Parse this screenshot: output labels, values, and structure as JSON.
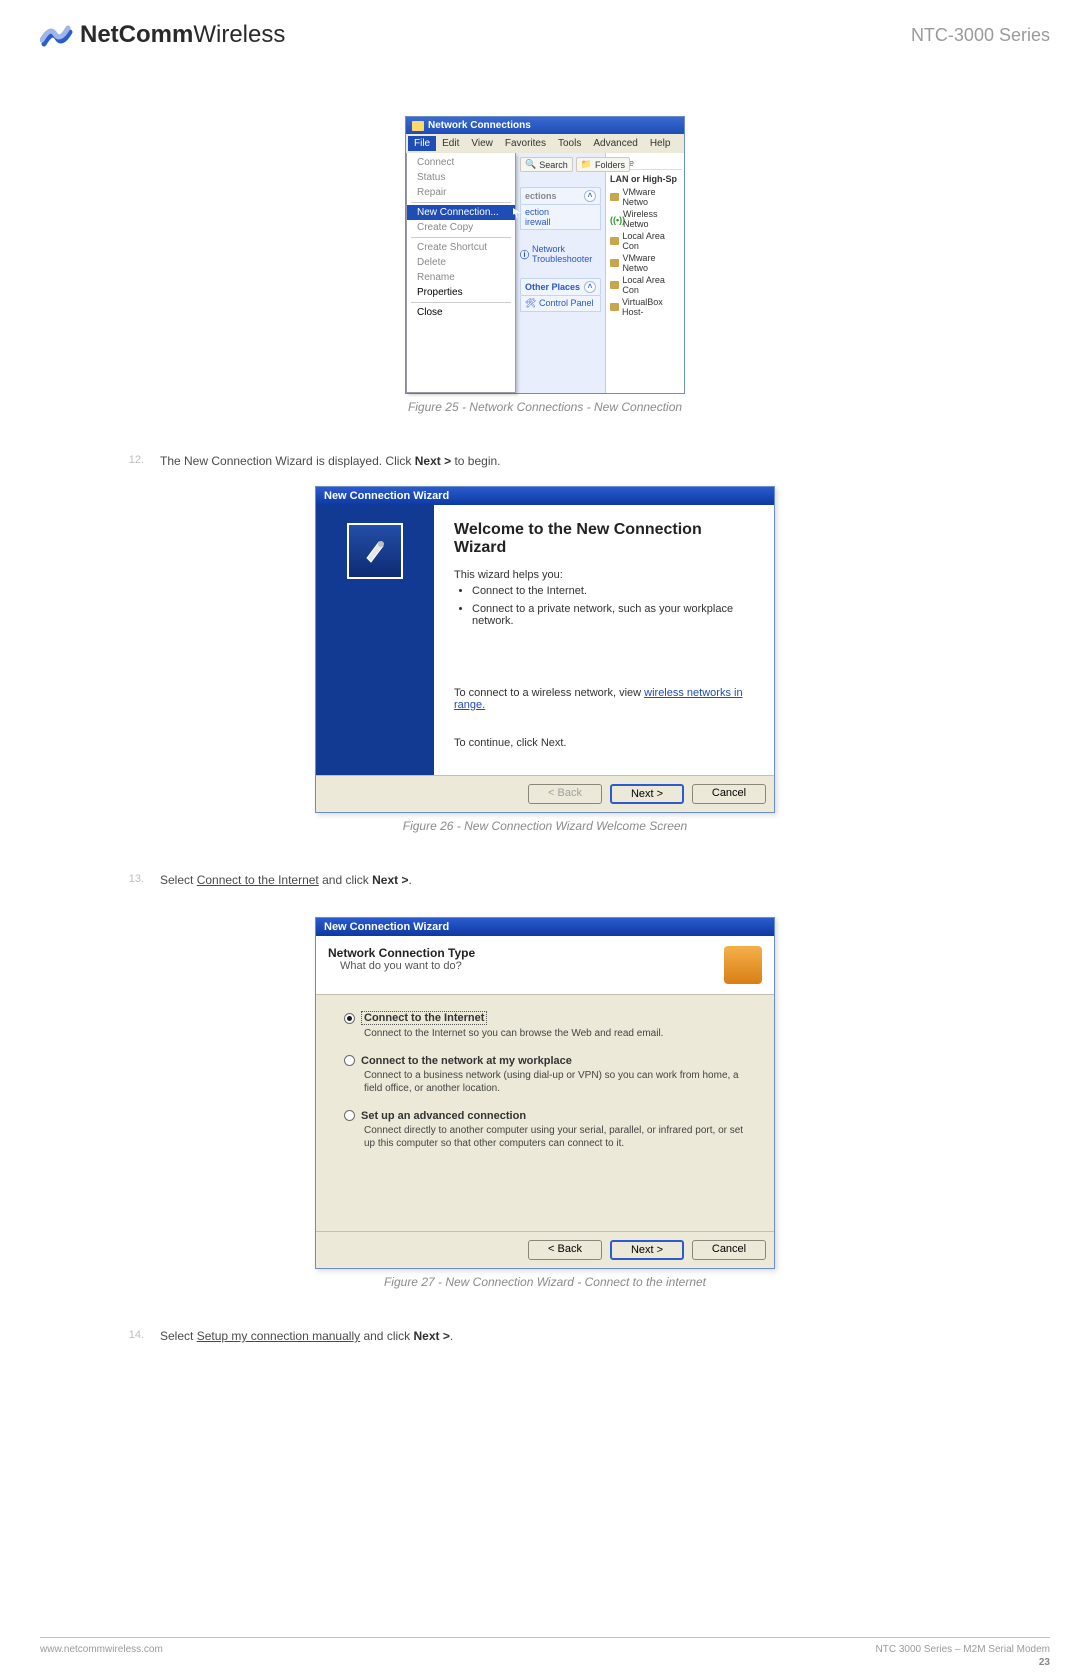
{
  "header": {
    "brand_strong": "NetComm",
    "brand_light": "Wireless",
    "series": "NTC-3000 Series"
  },
  "fig25": {
    "window_title": "Network Connections",
    "menus": [
      "File",
      "Edit",
      "View",
      "Favorites",
      "Tools",
      "Advanced",
      "Help"
    ],
    "file_menu": {
      "items": [
        "Connect",
        "Status",
        "Repair",
        "New Connection...",
        "Create Copy",
        "Create Shortcut",
        "Delete",
        "Rename",
        "Properties",
        "Close"
      ],
      "highlighted": "New Connection..."
    },
    "toolbar": {
      "search": "Search",
      "folders": "Folders"
    },
    "midpanel": {
      "netconn_link": "ection",
      "firewall_link": "irewall",
      "troubleshooter": "Network Troubleshooter",
      "other_places": "Other Places",
      "control_panel": "Control Panel",
      "sections_label": "ections"
    },
    "right": {
      "col_name": "Name",
      "group": "LAN or High-Sp",
      "items": [
        "VMware Netwo",
        "Wireless Netwo",
        "Local Area Con",
        "VMware Netwo",
        "Local Area Con",
        "VirtualBox Host-"
      ]
    },
    "caption": "Figure 25 - Network Connections - New Connection"
  },
  "step12": {
    "num": "12.",
    "pre": "The New Connection Wizard is displayed. Click ",
    "bold": "Next >",
    "post": " to begin."
  },
  "fig26": {
    "window_title": "New Connection Wizard",
    "heading": "Welcome to the New Connection Wizard",
    "helps": "This wizard helps you:",
    "b1": "Connect to the Internet.",
    "b2": "Connect to a private network, such as your workplace network.",
    "wireless_pre": "To connect to a wireless network, view ",
    "wireless_link": "wireless networks in range.",
    "continue": "To continue, click Next.",
    "buttons": {
      "back": "< Back",
      "next": "Next >",
      "cancel": "Cancel"
    },
    "caption": "Figure 26 - New Connection Wizard Welcome Screen"
  },
  "step13": {
    "num": "13.",
    "pre": "Select ",
    "underline": "Connect to the Internet",
    "mid": " and click ",
    "bold": "Next >",
    "post": "."
  },
  "fig27": {
    "window_title": "New Connection Wizard",
    "header_title": "Network Connection Type",
    "header_sub": "What do you want to do?",
    "opt1": {
      "label": "Connect to the Internet",
      "desc": "Connect to the Internet so you can browse the Web and read email."
    },
    "opt2": {
      "label": "Connect to the network at my workplace",
      "desc": "Connect to a business network (using dial-up or VPN) so you can work from home, a field office, or another location."
    },
    "opt3": {
      "label": "Set up an advanced connection",
      "desc": "Connect directly to another computer using your serial, parallel, or infrared port, or set up this computer so that other computers can connect to it."
    },
    "buttons": {
      "back": "< Back",
      "next": "Next >",
      "cancel": "Cancel"
    },
    "caption": "Figure 27 - New Connection Wizard - Connect to the internet"
  },
  "step14": {
    "num": "14.",
    "pre": "Select ",
    "underline": "Setup my connection manually",
    "mid": " and click ",
    "bold": "Next >",
    "post": "."
  },
  "footer": {
    "url": "www.netcommwireless.com",
    "product": "NTC 3000 Series – M2M Serial Modem",
    "page": "23"
  }
}
